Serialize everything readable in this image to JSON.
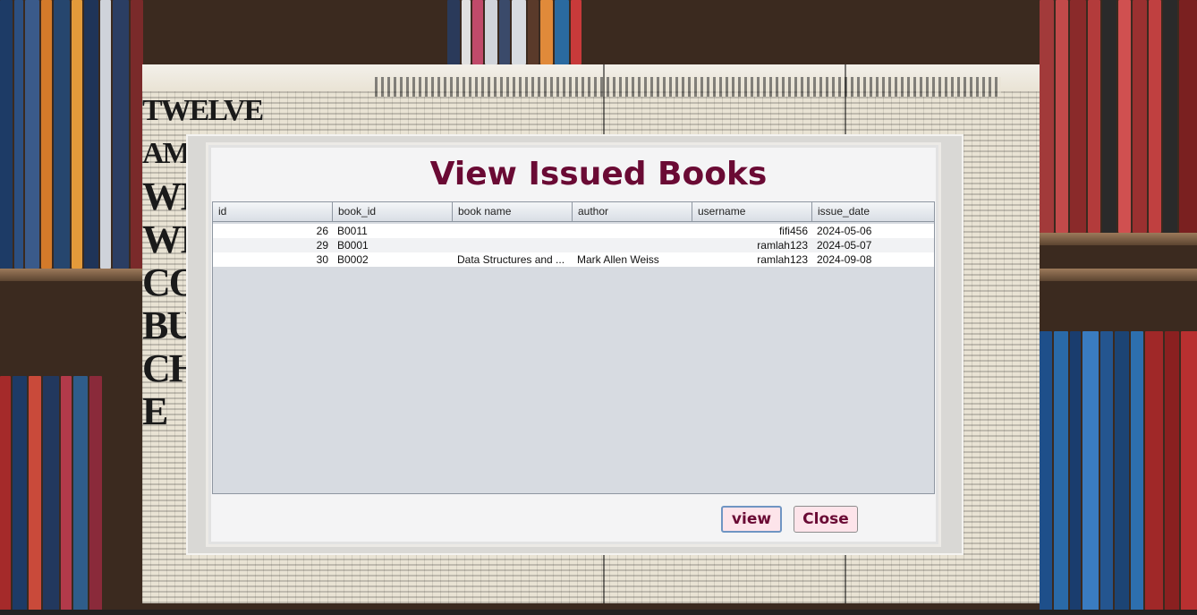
{
  "dialog": {
    "title": "View Issued Books"
  },
  "table": {
    "columns": [
      "id",
      "book_id",
      "book name",
      "author",
      "username",
      "issue_date"
    ],
    "rows": [
      {
        "id": "26",
        "book_id": "B0011",
        "book_name": "",
        "author": "",
        "username": "fifi456",
        "issue_date": "2024-05-06"
      },
      {
        "id": "29",
        "book_id": "B0001",
        "book_name": "",
        "author": "",
        "username": "ramlah123",
        "issue_date": "2024-05-07"
      },
      {
        "id": "30",
        "book_id": "B0002",
        "book_name": "Data Structures and ...",
        "author": "Mark Allen Weiss",
        "username": "ramlah123",
        "issue_date": "2024-09-08"
      }
    ]
  },
  "buttons": {
    "view_label": "view",
    "close_label": "Close"
  },
  "background": {
    "headline_lines": [
      "TWELVE",
      "AMERICAN",
      "WI",
      "WI",
      "CO",
      "BU",
      "CH",
      "E"
    ]
  },
  "colors": {
    "title": "#6a0a34",
    "button_bg": "#fde4ea",
    "table_bg": "#d7dbe1"
  }
}
